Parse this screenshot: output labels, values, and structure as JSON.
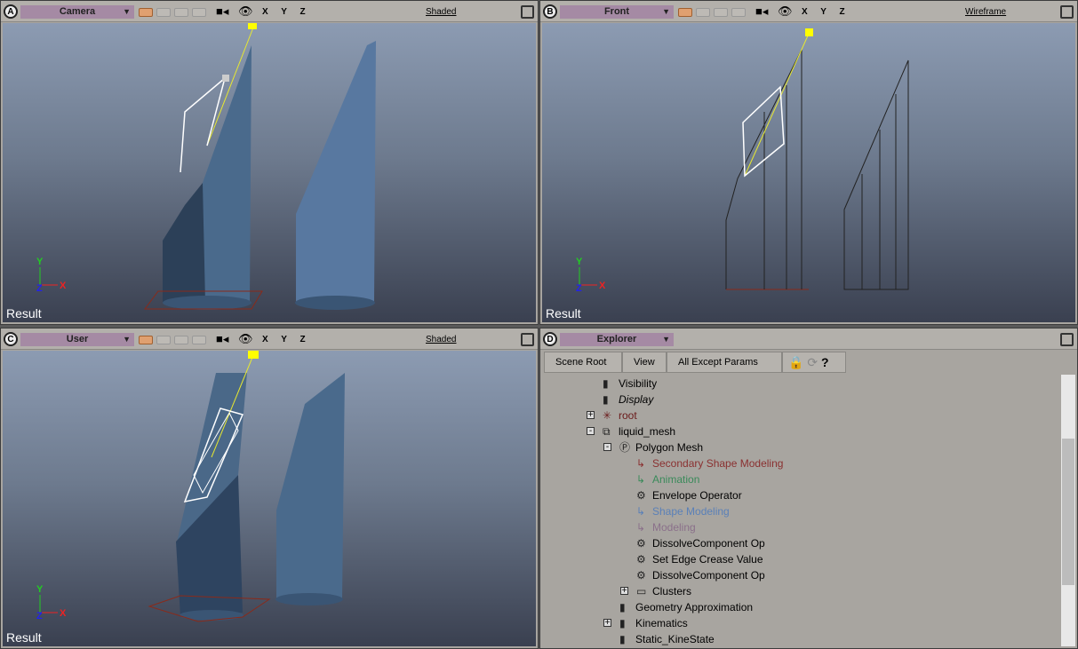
{
  "viewports": [
    {
      "letter": "A",
      "view": "Camera",
      "mode": "Shaded",
      "axes": "X Y Z",
      "result": "Result"
    },
    {
      "letter": "B",
      "view": "Front",
      "mode": "Wireframe",
      "axes": "X Y Z",
      "result": "Result"
    },
    {
      "letter": "C",
      "view": "User",
      "mode": "Shaded",
      "axes": "X Y Z",
      "result": "Result"
    }
  ],
  "explorer": {
    "letter": "D",
    "title": "Explorer",
    "toolbar": {
      "scene_root": "Scene Root",
      "view": "View",
      "filter": "All Except Params"
    },
    "items": [
      {
        "label": "Visibility",
        "icon": "property-icon",
        "color": "#000000",
        "italic": false
      },
      {
        "label": "Display",
        "icon": "property-icon",
        "color": "#000000",
        "italic": true
      },
      {
        "label": "root",
        "icon": "null-icon",
        "color": "#6a1a1a",
        "expand": "+"
      },
      {
        "label": "liquid_mesh",
        "icon": "mesh-object-icon",
        "color": "#000000",
        "expand": "-"
      },
      {
        "label": "Polygon Mesh",
        "icon": "polygon-mesh-icon",
        "color": "#000000",
        "expand": "-"
      },
      {
        "label": "Secondary Shape Modeling",
        "icon": "marker-icon",
        "color": "#8a3030"
      },
      {
        "label": "Animation",
        "icon": "marker-icon",
        "color": "#3a8a5a"
      },
      {
        "label": "Envelope Operator",
        "icon": "operator-gear-icon",
        "color": "#000000"
      },
      {
        "label": "Shape Modeling",
        "icon": "marker-icon",
        "color": "#5a80b8"
      },
      {
        "label": "Modeling",
        "icon": "marker-icon",
        "color": "#8a708a"
      },
      {
        "label": "DissolveComponent Op",
        "icon": "operator-gear-icon",
        "color": "#000000"
      },
      {
        "label": "Set Edge Crease Value",
        "icon": "operator-gear-icon",
        "color": "#000000"
      },
      {
        "label": "DissolveComponent Op",
        "icon": "operator-gear-icon",
        "color": "#000000"
      },
      {
        "label": "Clusters",
        "icon": "folder-icon",
        "color": "#000000",
        "expand": "+"
      },
      {
        "label": "Geometry Approximation",
        "icon": "property-icon",
        "color": "#000000"
      },
      {
        "label": "Kinematics",
        "icon": "property-icon",
        "color": "#000000",
        "expand": "+"
      },
      {
        "label": "Static_KineState",
        "icon": "property-icon",
        "color": "#000000"
      }
    ]
  }
}
